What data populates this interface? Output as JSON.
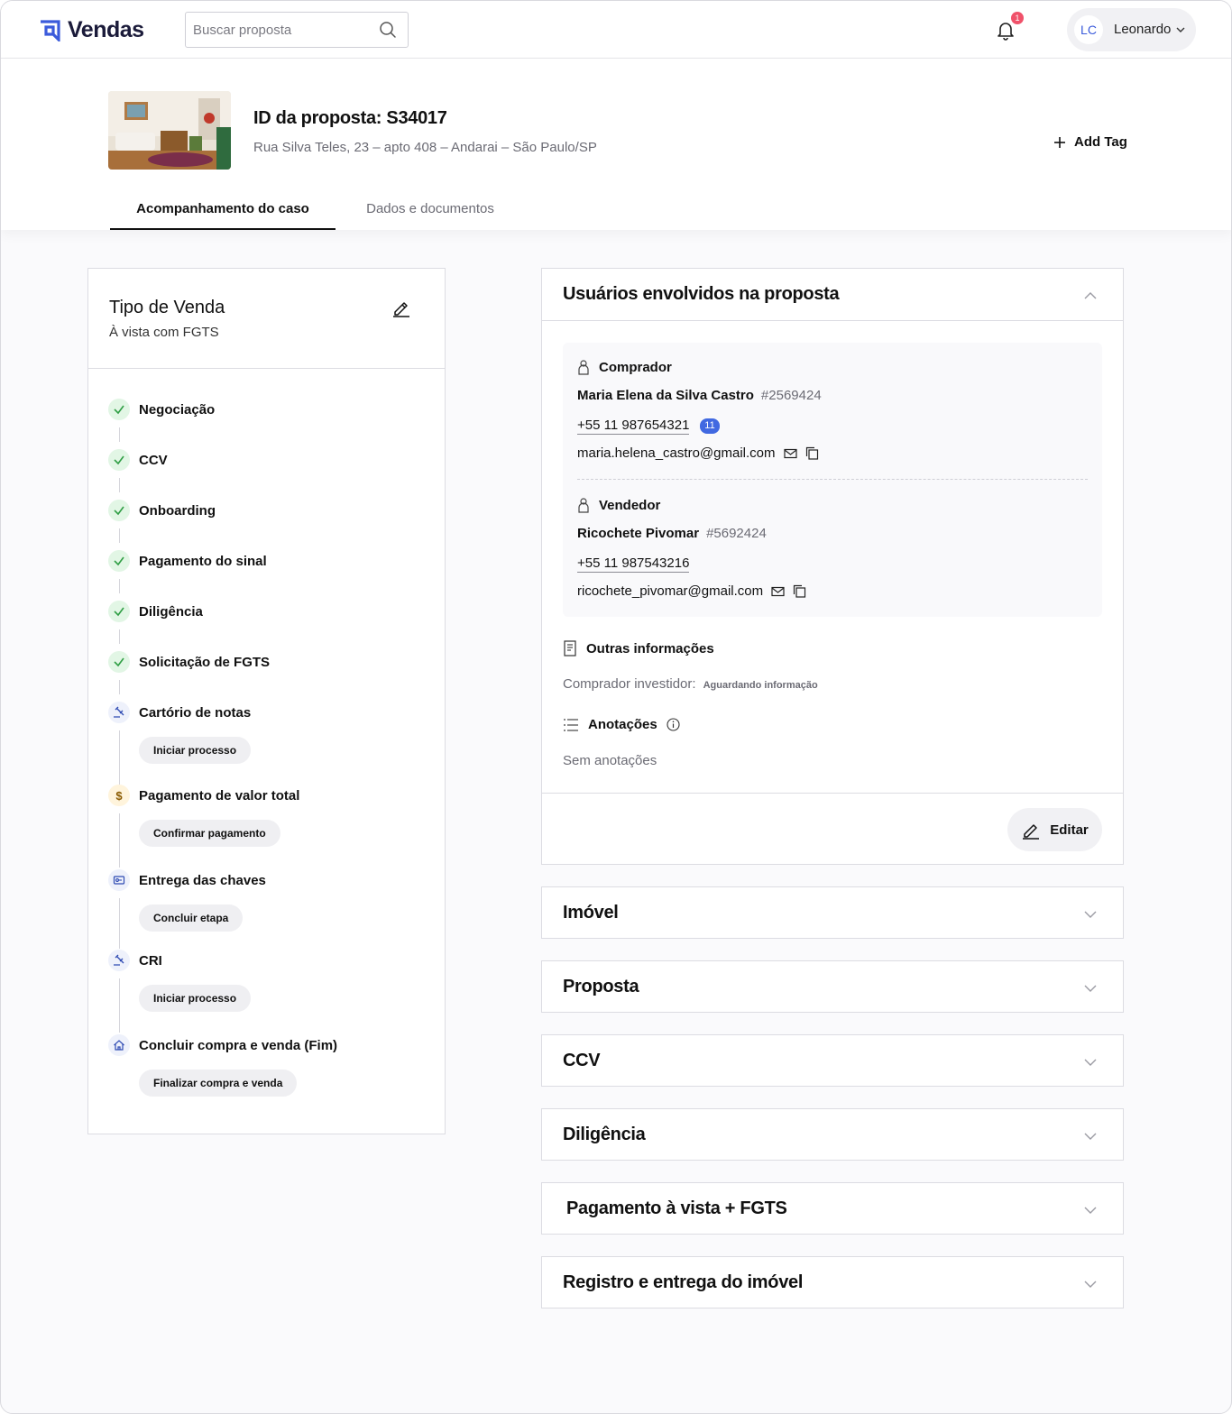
{
  "app": {
    "name": "Vendas"
  },
  "search": {
    "placeholder": "Buscar proposta"
  },
  "notifications": {
    "count": "1"
  },
  "user": {
    "initials": "LC",
    "name": "Leonardo"
  },
  "proposal": {
    "id_label": "ID da proposta: S34017",
    "address": "Rua Silva Teles, 23 – apto 408 – Andarai – São Paulo/SP",
    "add_tag": "Add Tag"
  },
  "tabs": [
    {
      "label": "Acompanhamento do caso",
      "active": true
    },
    {
      "label": "Dados e documentos",
      "active": false
    }
  ],
  "sale_type": {
    "title": "Tipo de Venda",
    "value": "À vista com FGTS"
  },
  "steps": [
    {
      "label": "Negociação",
      "status": "done"
    },
    {
      "label": "CCV",
      "status": "done"
    },
    {
      "label": "Onboarding",
      "status": "done"
    },
    {
      "label": "Pagamento do sinal",
      "status": "done"
    },
    {
      "label": "Diligência",
      "status": "done"
    },
    {
      "label": "Solicitação de FGTS",
      "status": "done"
    },
    {
      "label": "Cartório de notas",
      "status": "pending",
      "icon": "gavel-icon",
      "action": "Iniciar processo"
    },
    {
      "label": "Pagamento de valor total",
      "status": "pending",
      "icon": "dollar-icon",
      "action": "Confirmar pagamento"
    },
    {
      "label": "Entrega das chaves",
      "status": "pending",
      "icon": "key-icon",
      "action": "Concluir etapa"
    },
    {
      "label": "CRI",
      "status": "pending",
      "icon": "gavel-icon",
      "action": "Iniciar processo"
    },
    {
      "label": "Concluir compra e venda (Fim)",
      "status": "pending",
      "icon": "house-icon",
      "action": "Finalizar compra e venda"
    }
  ],
  "users_card": {
    "title": "Usuários envolvidos na proposta",
    "buyer": {
      "role": "Comprador",
      "name": "Maria Elena da Silva Castro",
      "id": "#2569424",
      "phone": "+55 11 987654321",
      "phone_badge": "11",
      "email": "maria.helena_castro@gmail.com"
    },
    "seller": {
      "role": "Vendedor",
      "name": "Ricochete Pivomar",
      "id": "#5692424",
      "phone": "+55 11 987543216",
      "email": "ricochete_pivomar@gmail.com"
    },
    "other_info": {
      "title": "Outras informações",
      "key": "Comprador investidor:",
      "value": "Aguardando informação"
    },
    "notes": {
      "title": "Anotações",
      "empty": "Sem anotações"
    },
    "edit_label": "Editar"
  },
  "accordions": [
    {
      "title": "Imóvel"
    },
    {
      "title": "Proposta"
    },
    {
      "title": "CCV"
    },
    {
      "title": "Diligência"
    },
    {
      "title": "Pagamento à vista + FGTS"
    },
    {
      "title": "Registro e entrega do imóvel"
    }
  ],
  "colors": {
    "brand": "#3b5bdb",
    "done_bg": "#e2f6e5",
    "done_check": "#2f9e44",
    "badge": "#4169e1",
    "notification": "#f0526a"
  }
}
